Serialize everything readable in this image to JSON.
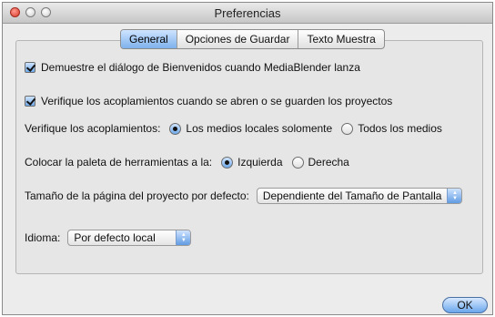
{
  "window": {
    "title": "Preferencias"
  },
  "tabs": [
    {
      "label": "General",
      "selected": true
    },
    {
      "label": "Opciones de Guardar",
      "selected": false
    },
    {
      "label": "Texto Muestra",
      "selected": false
    }
  ],
  "general": {
    "welcome_checkbox": {
      "label": "Demuestre el diálogo de Bienvenidos cuando MediaBlender lanza",
      "checked": true
    },
    "verify_checkbox": {
      "label": "Verifique los acoplamientos cuando se abren o se guarden los proyectos",
      "checked": true
    },
    "verify_scope": {
      "label": "Verifique los acoplamientos:",
      "options": [
        {
          "label": "Los medios locales solomente",
          "selected": true
        },
        {
          "label": "Todos los medios",
          "selected": false
        }
      ]
    },
    "palette_position": {
      "label": "Colocar la paleta de herramientas a la:",
      "options": [
        {
          "label": "Izquierda",
          "selected": true
        },
        {
          "label": "Derecha",
          "selected": false
        }
      ]
    },
    "page_size": {
      "label": "Tamaño de la página del proyecto por defecto:",
      "value": "Dependiente del Tamaño de Pantalla"
    },
    "language": {
      "label": "Idioma:",
      "value": "Por defecto local"
    }
  },
  "buttons": {
    "ok": "OK"
  },
  "colors": {
    "accent": "#6fa8e8",
    "close_light": "#d6392a"
  },
  "icons": {
    "popup": "up-down-arrows-icon",
    "check": "checkmark-icon",
    "radio": "radio-dot-icon"
  }
}
